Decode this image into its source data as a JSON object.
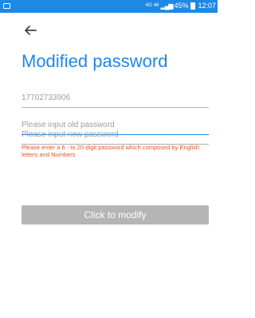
{
  "status_bar": {
    "network": "4G",
    "signal": "46",
    "battery": "45%",
    "time": "12:07"
  },
  "header": {
    "back_icon": "arrow-left-icon",
    "title": "Modified password"
  },
  "form": {
    "phone_value": "17702733906",
    "old_password_placeholder": "Please input old password",
    "new_password_placeholder": "Please input new password",
    "error_message": "Please enter a 6 - to 20-digit password which composed by English letters and Numbers",
    "submit_label": "Click to modify"
  },
  "colors": {
    "accent": "#1e88e5",
    "error": "#f0501e",
    "button_disabled": "#b5b5b5"
  }
}
